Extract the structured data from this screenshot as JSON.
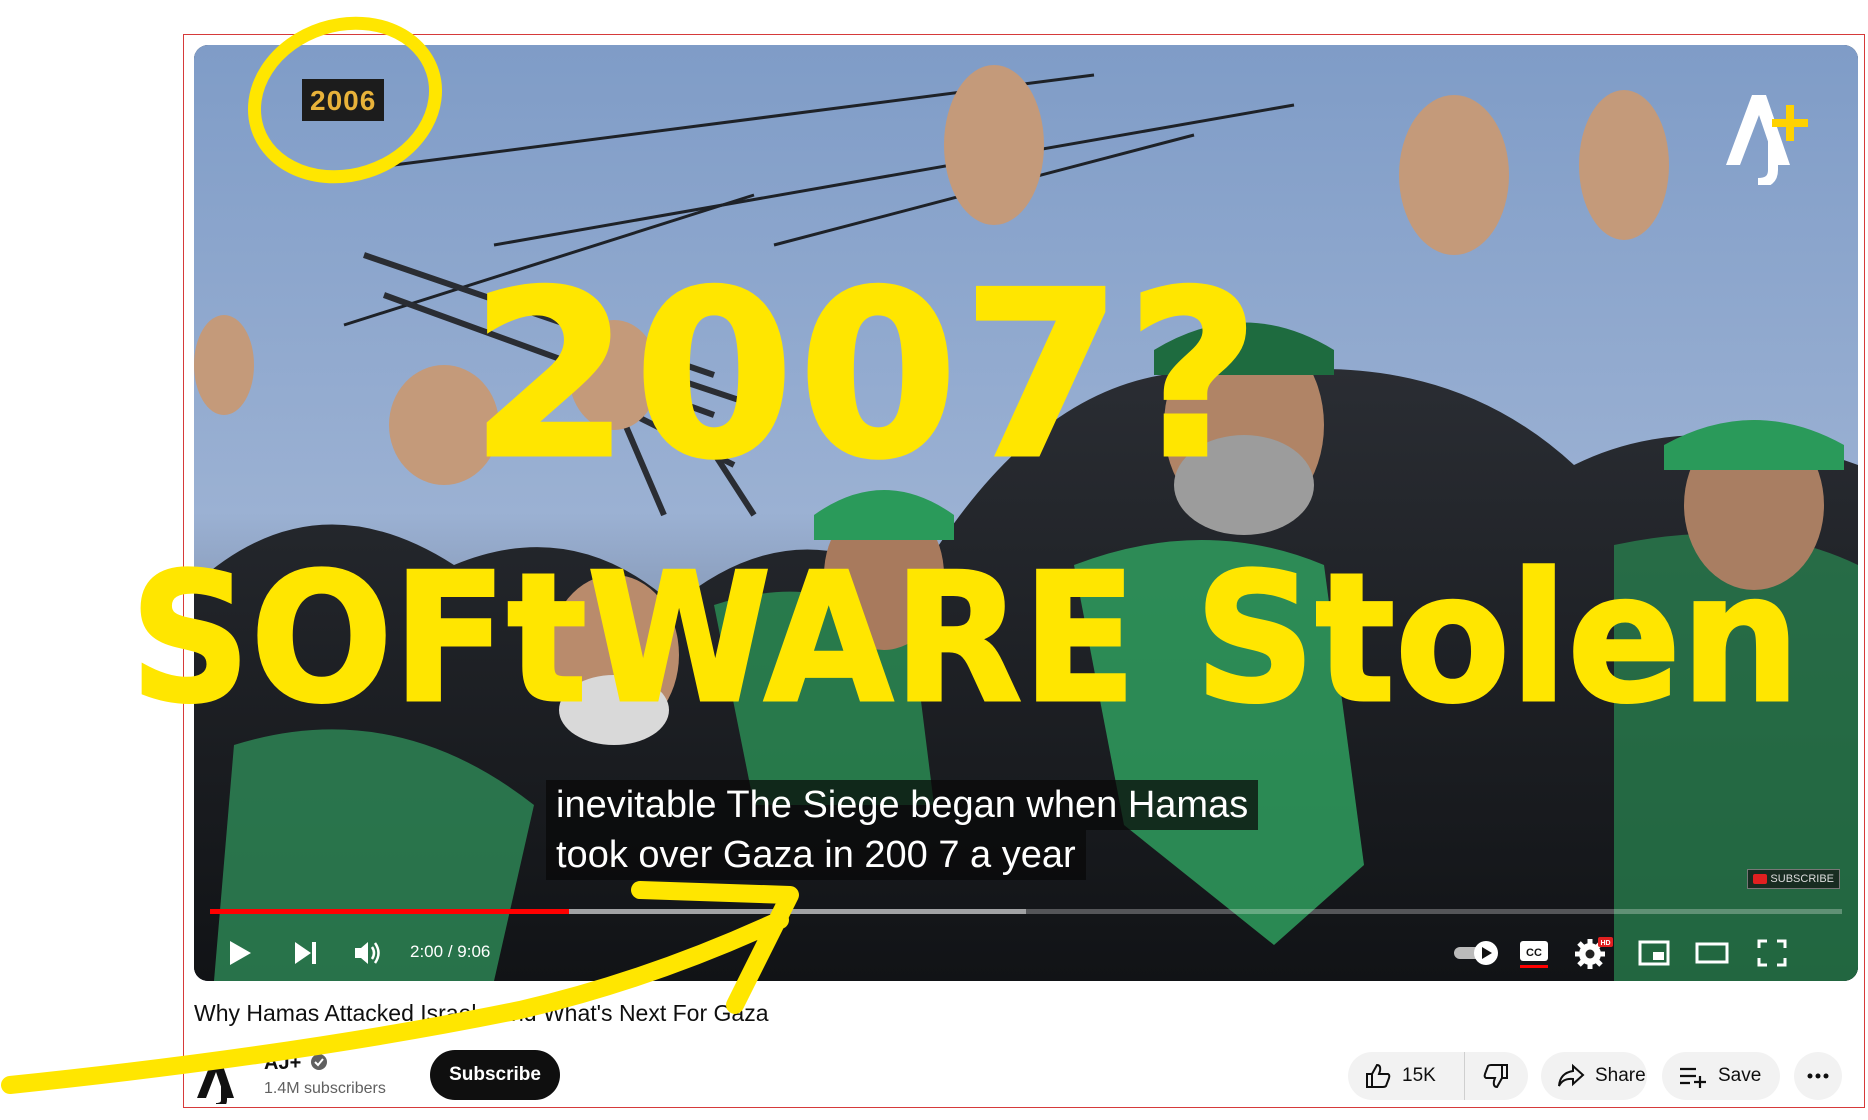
{
  "video": {
    "year_badge": "2006",
    "caption_line1": "inevitable The Siege began when Hamas",
    "caption_line2": "took over Gaza in 200 7 a year",
    "watermark_subscribe": "SUBSCRIBE",
    "time_current": "2:00",
    "time_separator": " / ",
    "time_total": "9:06",
    "progress_played": 0.22,
    "progress_buffered": 0.5,
    "hd_badge": "HD",
    "cc_label": "CC"
  },
  "info": {
    "title": "Why Hamas Attacked Israel - And What's Next For Gaza",
    "channel_name": "AJ+",
    "subscribers": "1.4M subscribers",
    "subscribe_label": "Subscribe",
    "like_count": "15K",
    "share_label": "Share",
    "save_label": "Save"
  },
  "annotation": {
    "line1": "2007?",
    "line2": "SOFtWARE Stolen",
    "color": "#ffe600"
  },
  "icons": [
    "play-icon",
    "next-icon",
    "volume-icon",
    "autoplay-toggle-icon",
    "cc-icon",
    "settings-icon",
    "miniplayer-icon",
    "theater-icon",
    "fullscreen-icon",
    "like-icon",
    "dislike-icon",
    "share-icon",
    "save-icon",
    "more-icon",
    "verified-icon"
  ],
  "colors": {
    "accent": "#ff0000",
    "frame": "#d63a3a",
    "ink": "#ffe600"
  }
}
